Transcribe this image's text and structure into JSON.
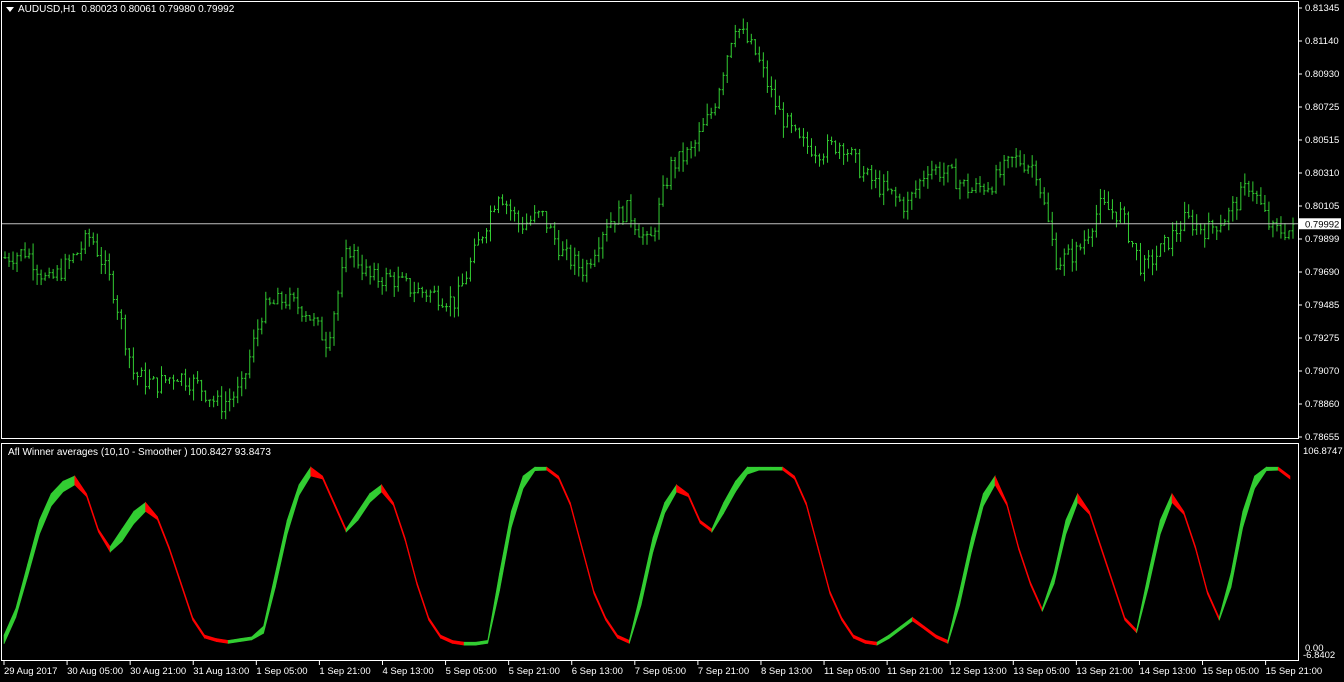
{
  "header": {
    "symbol": "AUDUSD,H1",
    "ohlc": "0.80023 0.80061 0.79980 0.79992"
  },
  "indicator": {
    "title": "Afl Winner averages (10,10 - Smoother ) 100.8427 93.8473",
    "scale_top": "106.8747",
    "scale_mid": "0.00",
    "scale_bottom": "-6.8402"
  },
  "price_axis": {
    "ticks": [
      "0.81345",
      "0.81140",
      "0.80930",
      "0.80725",
      "0.80515",
      "0.80310",
      "0.80105",
      "0.79899",
      "0.79690",
      "0.79485",
      "0.79275",
      "0.79070",
      "0.78860",
      "0.78655"
    ],
    "current": "0.79992"
  },
  "time_axis": {
    "ticks": [
      "29 Aug 2017",
      "30 Aug 05:00",
      "30 Aug 21:00",
      "31 Aug 13:00",
      "1 Sep 05:00",
      "1 Sep 21:00",
      "4 Sep 13:00",
      "5 Sep 05:00",
      "5 Sep 21:00",
      "6 Sep 13:00",
      "7 Sep 05:00",
      "7 Sep 21:00",
      "8 Sep 13:00",
      "11 Sep 05:00",
      "11 Sep 21:00",
      "12 Sep 13:00",
      "13 Sep 05:00",
      "13 Sep 21:00",
      "14 Sep 13:00",
      "15 Sep 05:00",
      "15 Sep 21:00"
    ]
  },
  "colors": {
    "background": "#000000",
    "bars": "#32cd32",
    "osc_up": "#32cd32",
    "osc_down": "#ff0000",
    "separator": "#ffffff"
  },
  "chart_data": [
    {
      "type": "ohlc",
      "title": "AUDUSD,H1",
      "ylim": [
        0.78655,
        0.81345
      ],
      "current_price": 0.79992,
      "x": [
        "29 Aug 2017",
        "30 Aug 05:00",
        "30 Aug 21:00",
        "31 Aug 13:00",
        "1 Sep 05:00",
        "1 Sep 21:00",
        "4 Sep 13:00",
        "5 Sep 05:00",
        "5 Sep 21:00",
        "6 Sep 13:00",
        "7 Sep 05:00",
        "7 Sep 21:00",
        "8 Sep 13:00",
        "11 Sep 05:00",
        "11 Sep 21:00",
        "12 Sep 13:00",
        "13 Sep 05:00",
        "13 Sep 21:00",
        "14 Sep 13:00",
        "15 Sep 05:00",
        "15 Sep 21:00"
      ],
      "close_path": [
        0.7978,
        0.7982,
        0.7962,
        0.7975,
        0.7992,
        0.796,
        0.7905,
        0.7898,
        0.7905,
        0.7898,
        0.7885,
        0.7895,
        0.7945,
        0.7952,
        0.7945,
        0.7925,
        0.7985,
        0.7965,
        0.7965,
        0.7958,
        0.7955,
        0.795,
        0.7985,
        0.802,
        0.7998,
        0.8005,
        0.798,
        0.797,
        0.8,
        0.8008,
        0.7985,
        0.8035,
        0.8045,
        0.8072,
        0.8125,
        0.8105,
        0.807,
        0.805,
        0.8045,
        0.805,
        0.803,
        0.802,
        0.801,
        0.8035,
        0.803,
        0.802,
        0.8025,
        0.804,
        0.8035,
        0.7975,
        0.7982,
        0.801,
        0.8005,
        0.797,
        0.7985,
        0.8002,
        0.7995,
        0.8005,
        0.8025,
        0.7995,
        0.7995
      ]
    },
    {
      "type": "area",
      "title": "Afl Winner averages (10,10 - Smoother ) 100.8427 93.8473",
      "ylim": [
        -6.8402,
        106.8747
      ],
      "series": [
        {
          "values": [
            5,
            20,
            45,
            70,
            85,
            92,
            95,
            85,
            65,
            55,
            65,
            75,
            80,
            72,
            55,
            35,
            15,
            5,
            3,
            2,
            3,
            4,
            10,
            40,
            70,
            90,
            100,
            95,
            80,
            65,
            75,
            85,
            90,
            80,
            60,
            35,
            15,
            5,
            2,
            1,
            1,
            2,
            40,
            75,
            95,
            100,
            100,
            95,
            80,
            55,
            30,
            15,
            5,
            2,
            30,
            60,
            80,
            90,
            85,
            70,
            65,
            80,
            92,
            100,
            100,
            100,
            100,
            95,
            80,
            55,
            30,
            15,
            5,
            2,
            1,
            5,
            10,
            15,
            10,
            5,
            2,
            30,
            60,
            85,
            95,
            80,
            55,
            35,
            20,
            40,
            70,
            85,
            75,
            55,
            35,
            15,
            8,
            40,
            70,
            85,
            75,
            55,
            30,
            15,
            40,
            75,
            95,
            100,
            100,
            95
          ]
        },
        {
          "values": [
            0,
            15,
            38,
            62,
            78,
            86,
            90,
            88,
            70,
            52,
            58,
            68,
            75,
            74,
            60,
            42,
            22,
            8,
            3,
            2,
            2,
            3,
            6,
            32,
            62,
            84,
            95,
            96,
            86,
            70,
            70,
            80,
            86,
            82,
            66,
            42,
            20,
            8,
            3,
            1,
            1,
            1,
            30,
            66,
            88,
            98,
            100,
            97,
            86,
            62,
            38,
            20,
            8,
            3,
            22,
            52,
            74,
            86,
            86,
            76,
            66,
            74,
            86,
            96,
            100,
            100,
            100,
            97,
            86,
            62,
            38,
            20,
            8,
            3,
            1,
            3,
            8,
            13,
            11,
            7,
            3,
            22,
            52,
            78,
            90,
            84,
            62,
            42,
            25,
            34,
            62,
            80,
            78,
            60,
            40,
            20,
            10,
            32,
            62,
            80,
            78,
            60,
            36,
            18,
            32,
            66,
            88,
            98,
            100,
            97
          ]
        }
      ]
    }
  ]
}
